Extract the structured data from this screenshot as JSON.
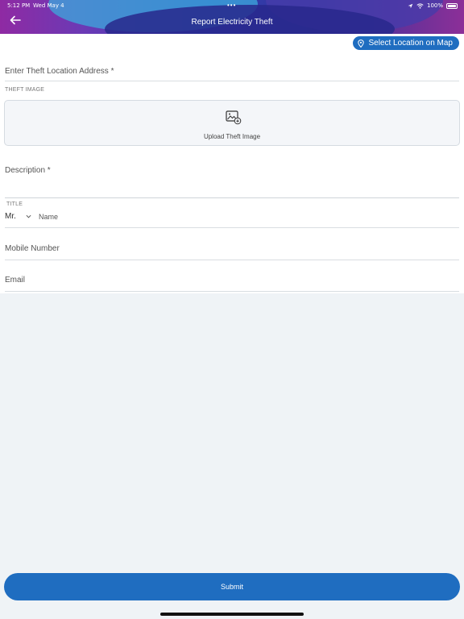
{
  "status_bar": {
    "time": "5:12 PM",
    "date": "Wed May 4",
    "battery": "100%"
  },
  "header": {
    "title": "Report Electricity Theft",
    "back_icon": "arrow-left-icon"
  },
  "map_button": {
    "label": "Select Location on Map",
    "icon": "location-pin-icon"
  },
  "form": {
    "address_label": "Enter Theft Location Address *",
    "theft_image_label": "THEFT IMAGE",
    "upload_label": "Upload Theft Image",
    "description_label": "Description *",
    "title_label": "TITLE",
    "title_value": "Mr.",
    "name_label": "Name",
    "mobile_label": "Mobile Number",
    "email_label": "Email"
  },
  "submit_label": "Submit",
  "colors": {
    "accent": "#1f6dc0",
    "background": "#eff3f6"
  }
}
